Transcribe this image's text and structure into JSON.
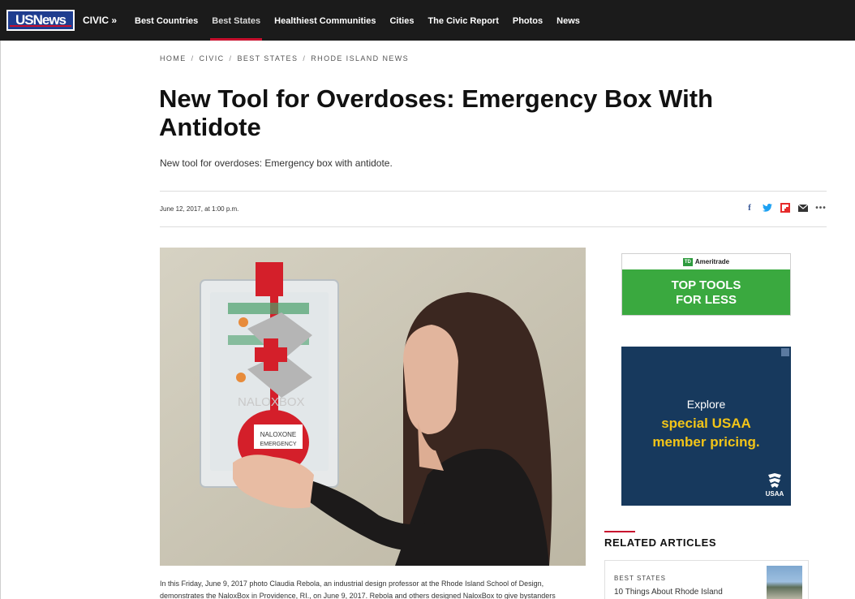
{
  "nav": {
    "logo_text": "USNews",
    "section": "CIVIC »",
    "items": [
      {
        "label": "Best Countries"
      },
      {
        "label": "Best States"
      },
      {
        "label": "Healthiest Communities"
      },
      {
        "label": "Cities"
      },
      {
        "label": "The Civic Report"
      },
      {
        "label": "Photos"
      },
      {
        "label": "News"
      }
    ],
    "active_item": "Best States",
    "accent_color": "#c8102e"
  },
  "breadcrumb": [
    "HOME",
    "CIVIC",
    "BEST STATES",
    "RHODE ISLAND NEWS"
  ],
  "article": {
    "headline": "New Tool for Overdoses: Emergency Box With Antidote",
    "dek": "New tool for overdoses: Emergency box with antidote.",
    "date": "June 12, 2017, at 1:00 p.m.",
    "share_icons": [
      "facebook-icon",
      "twitter-icon",
      "flipboard-icon",
      "email-icon",
      "more-icon"
    ],
    "photo": {
      "box_label": "NALOXBOX",
      "tag_line1": "NALOXONE",
      "tag_line2": "EMERGENCY"
    },
    "caption": "In this Friday, June 9, 2017 photo Claudia Rebola, an industrial design professor at the Rhode Island School of Design, demonstrates the NaloxBox in Providence, RI., on June 9, 2017. Rebola and others designed NaloxBox to give bystanders"
  },
  "ads": {
    "td": {
      "brand": "Ameritrade",
      "line1": "TOP TOOLS",
      "line2": "FOR LESS"
    },
    "usaa": {
      "line1": "Explore",
      "line2": "special USAA",
      "line3": "member pricing.",
      "logo_text": "USAA"
    }
  },
  "related": {
    "title": "RELATED ARTICLES",
    "items": [
      {
        "kicker": "BEST STATES",
        "title": "10 Things About Rhode Island"
      }
    ]
  }
}
